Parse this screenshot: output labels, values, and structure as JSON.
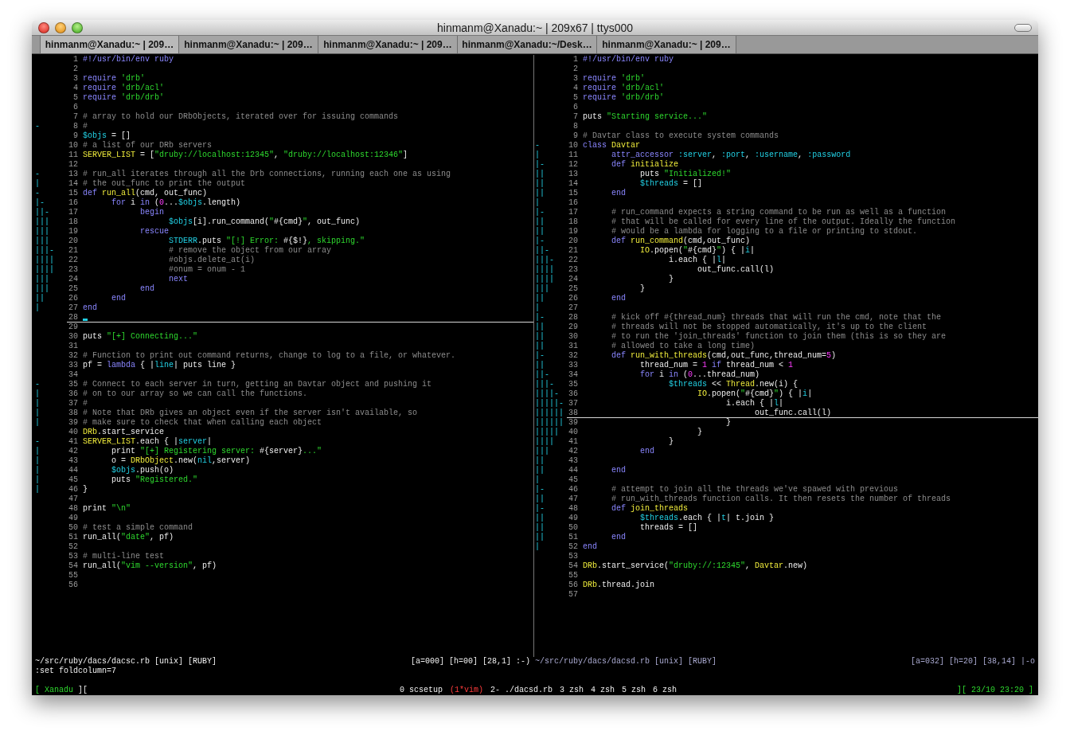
{
  "window": {
    "title": "hinmanm@Xanadu:~ | 209x67 | ttys000"
  },
  "tabs": [
    {
      "label": "hinmanm@Xanadu:~ | 209…",
      "selected": true
    },
    {
      "label": "hinmanm@Xanadu:~ | 209…",
      "selected": false
    },
    {
      "label": "hinmanm@Xanadu:~ | 209…",
      "selected": false
    },
    {
      "label": "hinmanm@Xanadu:~/Desk…",
      "selected": false
    },
    {
      "label": "hinmanm@Xanadu:~ | 209…",
      "selected": false
    }
  ],
  "panes": [
    {
      "active": true,
      "status_left": "~/src/ruby/dacs/dacsc.rb [unix] [RUBY]",
      "status_right": "[a=000] [h=00] [28,1] :-)",
      "lines": [
        {
          "number": "1",
          "cursor": false,
          "code": [
            {
              "kind": "keyword",
              "text": "#!/usr/bin/env ruby"
            }
          ]
        },
        {
          "number": "2",
          "cursor": false
        },
        {
          "number": "3",
          "cursor": false,
          "code": [
            {
              "kind": "keyword",
              "text": "require "
            },
            {
              "kind": "string",
              "text": "'drb'"
            }
          ]
        },
        {
          "number": "4",
          "cursor": false,
          "code": [
            {
              "kind": "keyword",
              "text": "require "
            },
            {
              "kind": "string",
              "text": "'drb/acl'"
            }
          ]
        },
        {
          "number": "5",
          "cursor": false,
          "code": [
            {
              "kind": "keyword",
              "text": "require "
            },
            {
              "kind": "string",
              "text": "'drb/drb'"
            }
          ]
        },
        {
          "number": "6",
          "cursor": false
        },
        {
          "number": "7",
          "cursor": false,
          "code": [
            {
              "kind": "comment",
              "text": "# array to hold our DRbObjects, iterated over for issuing commands"
            }
          ]
        },
        {
          "number": "8",
          "fold": "-",
          "cursor": false,
          "code": [
            {
              "kind": "comment",
              "text": "#"
            }
          ]
        },
        {
          "number": "9",
          "cursor": false,
          "code": [
            {
              "kind": "variable",
              "text": "$objs"
            },
            {
              "kind": "plain",
              "text": " = []"
            }
          ]
        },
        {
          "number": "10",
          "cursor": false,
          "code": [
            {
              "kind": "comment",
              "text": "# a list of our DRb servers"
            }
          ]
        },
        {
          "number": "11",
          "cursor": false,
          "code": [
            {
              "kind": "constant",
              "text": "SERVER_LIST"
            },
            {
              "kind": "plain",
              "text": " = ["
            },
            {
              "kind": "string",
              "text": "\"druby://localhost:12345\""
            },
            {
              "kind": "plain",
              "text": ", "
            },
            {
              "kind": "string",
              "text": "\"druby://localhost:12346\""
            },
            {
              "kind": "plain",
              "text": "]"
            }
          ]
        },
        {
          "number": "12",
          "cursor": false
        },
        {
          "number": "13",
          "fold": "-",
          "cursor": false,
          "code": [
            {
              "kind": "comment",
              "text": "# run_all iterates through all the Drb connections, running each one as using"
            }
          ]
        },
        {
          "number": "14",
          "fold": "|",
          "cursor": false,
          "code": [
            {
              "kind": "comment",
              "text": "# the out_func to print the output"
            }
          ]
        },
        {
          "number": "15",
          "fold": "-",
          "cursor": false,
          "code": [
            {
              "kind": "keyword",
              "text": "def "
            },
            {
              "kind": "constant",
              "text": "run_all"
            },
            {
              "kind": "plain",
              "text": "(cmd, out_func)"
            }
          ]
        },
        {
          "number": "16",
          "fold": "|-",
          "cursor": false,
          "code": [
            {
              "kind": "keyword",
              "text": "      for "
            },
            {
              "kind": "plain",
              "text": "i "
            },
            {
              "kind": "keyword",
              "text": "in "
            },
            {
              "kind": "plain",
              "text": "("
            },
            {
              "kind": "number",
              "text": "0"
            },
            {
              "kind": "plain",
              "text": "..."
            },
            {
              "kind": "variable",
              "text": "$objs"
            },
            {
              "kind": "plain",
              "text": ".length)"
            }
          ]
        },
        {
          "number": "17",
          "fold": "||-",
          "cursor": false,
          "code": [
            {
              "kind": "keyword",
              "text": "            begin"
            }
          ]
        },
        {
          "number": "18",
          "fold": "|||",
          "cursor": false,
          "code": [
            {
              "kind": "variable",
              "text": "                  $objs"
            },
            {
              "kind": "plain",
              "text": "[i].run_command("
            },
            {
              "kind": "string",
              "text": "\""
            },
            {
              "kind": "plain",
              "text": "#{cmd}"
            },
            {
              "kind": "string",
              "text": "\""
            },
            {
              "kind": "plain",
              "text": ", out_func)"
            }
          ]
        },
        {
          "number": "19",
          "fold": "|||",
          "cursor": false,
          "code": [
            {
              "kind": "keyword",
              "text": "            rescue"
            }
          ]
        },
        {
          "number": "20",
          "fold": "|||",
          "cursor": false,
          "code": [
            {
              "kind": "variable",
              "text": "                  STDERR"
            },
            {
              "kind": "plain",
              "text": ".puts "
            },
            {
              "kind": "string",
              "text": "\"[!] Error: "
            },
            {
              "kind": "plain",
              "text": "#{$!}"
            },
            {
              "kind": "string",
              "text": ", skipping.\""
            }
          ]
        },
        {
          "number": "21",
          "fold": "|||-",
          "cursor": false,
          "code": [
            {
              "kind": "comment",
              "text": "                  # remove the object from our array"
            }
          ]
        },
        {
          "number": "22",
          "fold": "||||",
          "cursor": false,
          "code": [
            {
              "kind": "comment",
              "text": "                  #objs.delete_at(i)"
            }
          ]
        },
        {
          "number": "23",
          "fold": "||||",
          "cursor": false,
          "code": [
            {
              "kind": "comment",
              "text": "                  #onum = onum - 1"
            }
          ]
        },
        {
          "number": "24",
          "fold": "|||",
          "cursor": false,
          "code": [
            {
              "kind": "keyword",
              "text": "                  next"
            }
          ]
        },
        {
          "number": "25",
          "fold": "|||",
          "cursor": false,
          "code": [
            {
              "kind": "keyword",
              "text": "            end"
            }
          ]
        },
        {
          "number": "26",
          "fold": "||",
          "cursor": false,
          "code": [
            {
              "kind": "keyword",
              "text": "      end"
            }
          ]
        },
        {
          "number": "27",
          "fold": "|",
          "cursor": false,
          "code": [
            {
              "kind": "keyword",
              "text": "end"
            }
          ]
        },
        {
          "number": "28",
          "cursor": true
        },
        {
          "number": "29",
          "cursor": false
        },
        {
          "number": "30",
          "cursor": false,
          "code": [
            {
              "kind": "plain",
              "text": "puts "
            },
            {
              "kind": "string",
              "text": "\"[+] Connecting...\""
            }
          ]
        },
        {
          "number": "31",
          "cursor": false
        },
        {
          "number": "32",
          "cursor": false,
          "code": [
            {
              "kind": "comment",
              "text": "# Function to print out command returns, change to log to a file, or whatever."
            }
          ]
        },
        {
          "number": "33",
          "cursor": false,
          "code": [
            {
              "kind": "plain",
              "text": "pf = "
            },
            {
              "kind": "keyword",
              "text": "lambda"
            },
            {
              "kind": "plain",
              "text": " { |"
            },
            {
              "kind": "variable",
              "text": "line"
            },
            {
              "kind": "plain",
              "text": "| puts line }"
            }
          ]
        },
        {
          "number": "34",
          "cursor": false
        },
        {
          "number": "35",
          "fold": "-",
          "cursor": false,
          "code": [
            {
              "kind": "comment",
              "text": "# Connect to each server in turn, getting an Davtar object and pushing it"
            }
          ]
        },
        {
          "number": "36",
          "fold": "|",
          "cursor": false,
          "code": [
            {
              "kind": "comment",
              "text": "# on to our array so we can call the functions."
            }
          ]
        },
        {
          "number": "37",
          "fold": "|",
          "cursor": false,
          "code": [
            {
              "kind": "comment",
              "text": "#"
            }
          ]
        },
        {
          "number": "38",
          "fold": "|",
          "cursor": false,
          "code": [
            {
              "kind": "comment",
              "text": "# Note that DRb gives an object even if the server isn't available, so"
            }
          ]
        },
        {
          "number": "39",
          "fold": "|",
          "cursor": false,
          "code": [
            {
              "kind": "comment",
              "text": "# make sure to check that when calling each object"
            }
          ]
        },
        {
          "number": "40",
          "cursor": false,
          "code": [
            {
              "kind": "constant",
              "text": "DRb"
            },
            {
              "kind": "plain",
              "text": ".start_service"
            }
          ]
        },
        {
          "number": "41",
          "fold": "-",
          "cursor": false,
          "code": [
            {
              "kind": "constant",
              "text": "SERVER_LIST"
            },
            {
              "kind": "plain",
              "text": ".each { |"
            },
            {
              "kind": "variable",
              "text": "server"
            },
            {
              "kind": "plain",
              "text": "|"
            }
          ]
        },
        {
          "number": "42",
          "fold": "|",
          "cursor": false,
          "code": [
            {
              "kind": "plain",
              "text": "      print "
            },
            {
              "kind": "string",
              "text": "\"[+] Registering server: "
            },
            {
              "kind": "plain",
              "text": "#{server}"
            },
            {
              "kind": "string",
              "text": "...\""
            }
          ]
        },
        {
          "number": "43",
          "fold": "|",
          "cursor": false,
          "code": [
            {
              "kind": "plain",
              "text": "      o = "
            },
            {
              "kind": "constant",
              "text": "DRbObject"
            },
            {
              "kind": "plain",
              "text": ".new("
            },
            {
              "kind": "variable",
              "text": "nil"
            },
            {
              "kind": "plain",
              "text": ",server)"
            }
          ]
        },
        {
          "number": "44",
          "fold": "|",
          "cursor": false,
          "code": [
            {
              "kind": "variable",
              "text": "      $objs"
            },
            {
              "kind": "plain",
              "text": ".push(o)"
            }
          ]
        },
        {
          "number": "45",
          "fold": "|",
          "cursor": false,
          "code": [
            {
              "kind": "plain",
              "text": "      puts "
            },
            {
              "kind": "string",
              "text": "\"Registered.\""
            }
          ]
        },
        {
          "number": "46",
          "fold": "|",
          "cursor": false,
          "code": [
            {
              "kind": "plain",
              "text": "}"
            }
          ]
        },
        {
          "number": "47",
          "cursor": false
        },
        {
          "number": "48",
          "cursor": false,
          "code": [
            {
              "kind": "plain",
              "text": "print "
            },
            {
              "kind": "string",
              "text": "\"\\n\""
            }
          ]
        },
        {
          "number": "49",
          "cursor": false
        },
        {
          "number": "50",
          "cursor": false,
          "code": [
            {
              "kind": "comment",
              "text": "# test a simple command"
            }
          ]
        },
        {
          "number": "51",
          "cursor": false,
          "code": [
            {
              "kind": "plain",
              "text": "run_all("
            },
            {
              "kind": "string",
              "text": "\"date\""
            },
            {
              "kind": "plain",
              "text": ", pf)"
            }
          ]
        },
        {
          "number": "52",
          "cursor": false
        },
        {
          "number": "53",
          "cursor": false,
          "code": [
            {
              "kind": "comment",
              "text": "# multi-line test"
            }
          ]
        },
        {
          "number": "54",
          "cursor": false,
          "code": [
            {
              "kind": "plain",
              "text": "run_all("
            },
            {
              "kind": "string",
              "text": "\"vim --version\""
            },
            {
              "kind": "plain",
              "text": ", pf)"
            }
          ]
        },
        {
          "number": "55",
          "cursor": false
        },
        {
          "number": "56",
          "cursor": false
        }
      ]
    },
    {
      "active": false,
      "status_left": "~/src/ruby/dacs/dacsd.rb [unix] [RUBY]",
      "status_right": "[a=032] [h=20] [38,14] |-o",
      "lines": [
        {
          "number": "1",
          "cursor": false,
          "code": [
            {
              "kind": "keyword",
              "text": "#!/usr/bin/env ruby"
            }
          ]
        },
        {
          "number": "2",
          "cursor": false
        },
        {
          "number": "3",
          "cursor": false,
          "code": [
            {
              "kind": "keyword",
              "text": "require "
            },
            {
              "kind": "string",
              "text": "'drb'"
            }
          ]
        },
        {
          "number": "4",
          "cursor": false,
          "code": [
            {
              "kind": "keyword",
              "text": "require "
            },
            {
              "kind": "string",
              "text": "'drb/acl'"
            }
          ]
        },
        {
          "number": "5",
          "cursor": false,
          "code": [
            {
              "kind": "keyword",
              "text": "require "
            },
            {
              "kind": "string",
              "text": "'drb/drb'"
            }
          ]
        },
        {
          "number": "6",
          "cursor": false
        },
        {
          "number": "7",
          "cursor": false,
          "code": [
            {
              "kind": "plain",
              "text": "puts "
            },
            {
              "kind": "string",
              "text": "\"Starting service...\""
            }
          ]
        },
        {
          "number": "8",
          "cursor": false
        },
        {
          "number": "9",
          "cursor": false,
          "code": [
            {
              "kind": "comment",
              "text": "# Davtar class to execute system commands"
            }
          ]
        },
        {
          "number": "10",
          "fold": "-",
          "cursor": false,
          "code": [
            {
              "kind": "keyword",
              "text": "class "
            },
            {
              "kind": "constant",
              "text": "Davtar"
            }
          ]
        },
        {
          "number": "11",
          "fold": "|",
          "cursor": false,
          "code": [
            {
              "kind": "keyword",
              "text": "      attr_accessor "
            },
            {
              "kind": "variable",
              "text": ":server"
            },
            {
              "kind": "plain",
              "text": ", "
            },
            {
              "kind": "variable",
              "text": ":port"
            },
            {
              "kind": "plain",
              "text": ", "
            },
            {
              "kind": "variable",
              "text": ":username"
            },
            {
              "kind": "plain",
              "text": ", "
            },
            {
              "kind": "variable",
              "text": ":password"
            }
          ]
        },
        {
          "number": "12",
          "fold": "|-",
          "cursor": false,
          "code": [
            {
              "kind": "keyword",
              "text": "      def "
            },
            {
              "kind": "constant",
              "text": "initialize"
            }
          ]
        },
        {
          "number": "13",
          "fold": "||",
          "cursor": false,
          "code": [
            {
              "kind": "plain",
              "text": "            puts "
            },
            {
              "kind": "string",
              "text": "\"Initialized!\""
            }
          ]
        },
        {
          "number": "14",
          "fold": "||",
          "cursor": false,
          "code": [
            {
              "kind": "variable",
              "text": "            $threads"
            },
            {
              "kind": "plain",
              "text": " = []"
            }
          ]
        },
        {
          "number": "15",
          "fold": "||",
          "cursor": false,
          "code": [
            {
              "kind": "keyword",
              "text": "      end"
            }
          ]
        },
        {
          "number": "16",
          "fold": "|",
          "cursor": false
        },
        {
          "number": "17",
          "fold": "|-",
          "cursor": false,
          "code": [
            {
              "kind": "comment",
              "text": "      # run_command expects a string command to be run as well as a function"
            }
          ]
        },
        {
          "number": "18",
          "fold": "||",
          "cursor": false,
          "code": [
            {
              "kind": "comment",
              "text": "      # that will be called for every line of the output. Ideally the function"
            }
          ]
        },
        {
          "number": "19",
          "fold": "||",
          "cursor": false,
          "code": [
            {
              "kind": "comment",
              "text": "      # would be a lambda for logging to a file or printing to stdout."
            }
          ]
        },
        {
          "number": "20",
          "fold": "|-",
          "cursor": false,
          "code": [
            {
              "kind": "keyword",
              "text": "      def "
            },
            {
              "kind": "constant",
              "text": "run_command"
            },
            {
              "kind": "plain",
              "text": "(cmd,out_func)"
            }
          ]
        },
        {
          "number": "21",
          "fold": "||-",
          "cursor": false,
          "code": [
            {
              "kind": "constant",
              "text": "            IO"
            },
            {
              "kind": "plain",
              "text": ".popen("
            },
            {
              "kind": "string",
              "text": "\""
            },
            {
              "kind": "plain",
              "text": "#{cmd}"
            },
            {
              "kind": "string",
              "text": "\""
            },
            {
              "kind": "plain",
              "text": ") { |"
            },
            {
              "kind": "variable",
              "text": "i"
            },
            {
              "kind": "plain",
              "text": "|"
            }
          ]
        },
        {
          "number": "22",
          "fold": "|||-",
          "cursor": false,
          "code": [
            {
              "kind": "plain",
              "text": "                  i.each { |"
            },
            {
              "kind": "variable",
              "text": "l"
            },
            {
              "kind": "plain",
              "text": "|"
            }
          ]
        },
        {
          "number": "23",
          "fold": "||||",
          "cursor": false,
          "code": [
            {
              "kind": "plain",
              "text": "                        out_func.call(l)"
            }
          ]
        },
        {
          "number": "24",
          "fold": "||||",
          "cursor": false,
          "code": [
            {
              "kind": "plain",
              "text": "                  }"
            }
          ]
        },
        {
          "number": "25",
          "fold": "|||",
          "cursor": false,
          "code": [
            {
              "kind": "plain",
              "text": "            }"
            }
          ]
        },
        {
          "number": "26",
          "fold": "||",
          "cursor": false,
          "code": [
            {
              "kind": "keyword",
              "text": "      end"
            }
          ]
        },
        {
          "number": "27",
          "fold": "|",
          "cursor": false
        },
        {
          "number": "28",
          "fold": "|-",
          "cursor": false,
          "code": [
            {
              "kind": "comment",
              "text": "      # kick off #{thread_num} threads that will run the cmd, note that the"
            }
          ]
        },
        {
          "number": "29",
          "fold": "||",
          "cursor": false,
          "code": [
            {
              "kind": "comment",
              "text": "      # threads will not be stopped automatically, it's up to the client"
            }
          ]
        },
        {
          "number": "30",
          "fold": "||",
          "cursor": false,
          "code": [
            {
              "kind": "comment",
              "text": "      # to run the 'join_threads' function to join them (this is so they are"
            }
          ]
        },
        {
          "number": "31",
          "fold": "||",
          "cursor": false,
          "code": [
            {
              "kind": "comment",
              "text": "      # allowed to take a long time)"
            }
          ]
        },
        {
          "number": "32",
          "fold": "|-",
          "cursor": false,
          "code": [
            {
              "kind": "keyword",
              "text": "      def "
            },
            {
              "kind": "constant",
              "text": "run_with_threads"
            },
            {
              "kind": "plain",
              "text": "(cmd,out_func,thread_num="
            },
            {
              "kind": "number",
              "text": "5"
            },
            {
              "kind": "plain",
              "text": ")"
            }
          ]
        },
        {
          "number": "33",
          "fold": "||",
          "cursor": false,
          "code": [
            {
              "kind": "plain",
              "text": "            thread_num = "
            },
            {
              "kind": "number",
              "text": "1"
            },
            {
              "kind": "keyword",
              "text": " if "
            },
            {
              "kind": "plain",
              "text": "thread_num < "
            },
            {
              "kind": "number",
              "text": "1"
            }
          ]
        },
        {
          "number": "34",
          "fold": "||-",
          "cursor": false,
          "code": [
            {
              "kind": "keyword",
              "text": "            for "
            },
            {
              "kind": "plain",
              "text": "i "
            },
            {
              "kind": "keyword",
              "text": "in "
            },
            {
              "kind": "plain",
              "text": "("
            },
            {
              "kind": "number",
              "text": "0"
            },
            {
              "kind": "plain",
              "text": "...thread_num)"
            }
          ]
        },
        {
          "number": "35",
          "fold": "|||-",
          "cursor": false,
          "code": [
            {
              "kind": "variable",
              "text": "                  $threads"
            },
            {
              "kind": "plain",
              "text": " << "
            },
            {
              "kind": "constant",
              "text": "Thread"
            },
            {
              "kind": "plain",
              "text": ".new(i) {"
            }
          ]
        },
        {
          "number": "36",
          "fold": "||||-",
          "cursor": false,
          "code": [
            {
              "kind": "constant",
              "text": "                        IO"
            },
            {
              "kind": "plain",
              "text": ".popen("
            },
            {
              "kind": "string",
              "text": "\""
            },
            {
              "kind": "plain",
              "text": "#{cmd}"
            },
            {
              "kind": "string",
              "text": "\""
            },
            {
              "kind": "plain",
              "text": ") { |"
            },
            {
              "kind": "variable",
              "text": "i"
            },
            {
              "kind": "plain",
              "text": "|"
            }
          ]
        },
        {
          "number": "37",
          "fold": "|||||-",
          "cursor": false,
          "code": [
            {
              "kind": "plain",
              "text": "                              i.each { |"
            },
            {
              "kind": "variable",
              "text": "l"
            },
            {
              "kind": "plain",
              "text": "|"
            }
          ]
        },
        {
          "number": "38",
          "fold": "||||||",
          "cursor": true,
          "code": [
            {
              "kind": "plain",
              "text": "                                    out_func.call(l)"
            }
          ]
        },
        {
          "number": "39",
          "fold": "||||||",
          "cursor": false,
          "code": [
            {
              "kind": "plain",
              "text": "                              }"
            }
          ]
        },
        {
          "number": "40",
          "fold": "|||||",
          "cursor": false,
          "code": [
            {
              "kind": "plain",
              "text": "                        }"
            }
          ]
        },
        {
          "number": "41",
          "fold": "||||",
          "cursor": false,
          "code": [
            {
              "kind": "plain",
              "text": "                  }"
            }
          ]
        },
        {
          "number": "42",
          "fold": "|||",
          "cursor": false,
          "code": [
            {
              "kind": "keyword",
              "text": "            end"
            }
          ]
        },
        {
          "number": "43",
          "fold": "||",
          "cursor": false
        },
        {
          "number": "44",
          "fold": "||",
          "cursor": false,
          "code": [
            {
              "kind": "keyword",
              "text": "      end"
            }
          ]
        },
        {
          "number": "45",
          "fold": "|",
          "cursor": false
        },
        {
          "number": "46",
          "fold": "|-",
          "cursor": false,
          "code": [
            {
              "kind": "comment",
              "text": "      # attempt to join all the threads we've spawed with previous"
            }
          ]
        },
        {
          "number": "47",
          "fold": "||",
          "cursor": false,
          "code": [
            {
              "kind": "comment",
              "text": "      # run_with_threads function calls. It then resets the number of threads"
            }
          ]
        },
        {
          "number": "48",
          "fold": "|-",
          "cursor": false,
          "code": [
            {
              "kind": "keyword",
              "text": "      def "
            },
            {
              "kind": "constant",
              "text": "join_threads"
            }
          ]
        },
        {
          "number": "49",
          "fold": "||",
          "cursor": false,
          "code": [
            {
              "kind": "variable",
              "text": "            $threads"
            },
            {
              "kind": "plain",
              "text": ".each { |"
            },
            {
              "kind": "variable",
              "text": "t"
            },
            {
              "kind": "plain",
              "text": "| t.join }"
            }
          ]
        },
        {
          "number": "50",
          "fold": "||",
          "cursor": false,
          "code": [
            {
              "kind": "plain",
              "text": "            threads = []"
            }
          ]
        },
        {
          "number": "51",
          "fold": "||",
          "cursor": false,
          "code": [
            {
              "kind": "keyword",
              "text": "      end"
            }
          ]
        },
        {
          "number": "52",
          "fold": "|",
          "cursor": false,
          "code": [
            {
              "kind": "keyword",
              "text": "end"
            }
          ]
        },
        {
          "number": "53",
          "cursor": false
        },
        {
          "number": "54",
          "cursor": false,
          "code": [
            {
              "kind": "constant",
              "text": "DRb"
            },
            {
              "kind": "plain",
              "text": ".start_service("
            },
            {
              "kind": "string",
              "text": "\"druby://:12345\""
            },
            {
              "kind": "plain",
              "text": ", "
            },
            {
              "kind": "constant",
              "text": "Davtar"
            },
            {
              "kind": "plain",
              "text": ".new)"
            }
          ]
        },
        {
          "number": "55",
          "cursor": false
        },
        {
          "number": "56",
          "cursor": false,
          "code": [
            {
              "kind": "constant",
              "text": "DRb"
            },
            {
              "kind": "plain",
              "text": ".thread.join"
            }
          ]
        },
        {
          "number": "57",
          "cursor": false
        }
      ]
    }
  ],
  "command_line": ":set foldcolumn=7",
  "screen_bar": {
    "host": "[ Xanadu",
    "host_close": "][",
    "windows": [
      {
        "label": "0 scsetup",
        "selected": false
      },
      {
        "label": "(1*vim)",
        "selected": true
      },
      {
        "label": "2- ./dacsd.rb",
        "selected": false
      },
      {
        "label": "3 zsh",
        "selected": false
      },
      {
        "label": "4 zsh",
        "selected": false
      },
      {
        "label": "5 zsh",
        "selected": false
      },
      {
        "label": "6 zsh",
        "selected": false
      }
    ],
    "clock": "][ 23/10 23:20 ]"
  }
}
